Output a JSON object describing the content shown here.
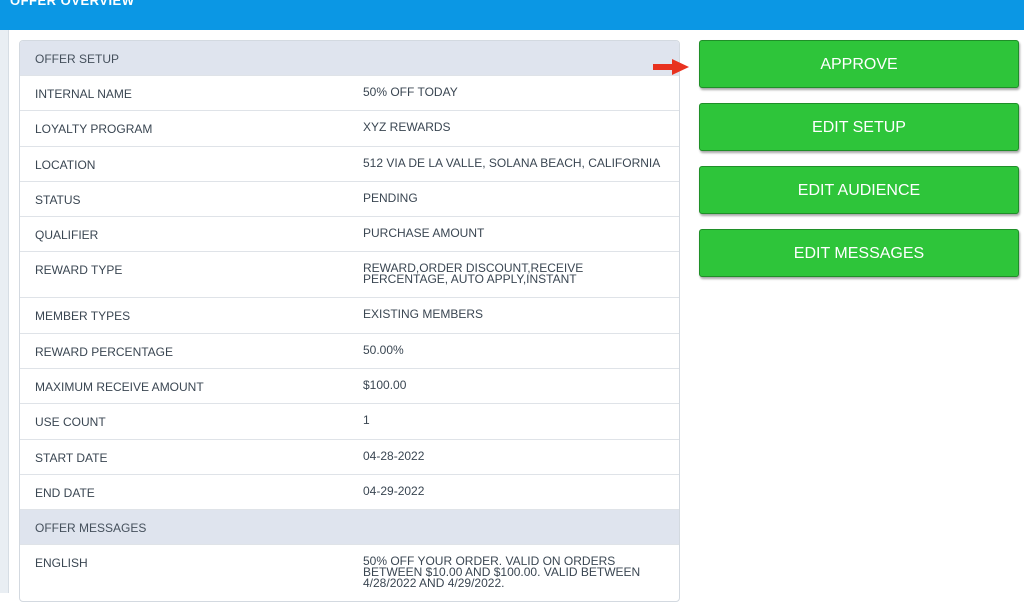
{
  "header": {
    "title": "OFFER OVERVIEW"
  },
  "offer_setup": {
    "section_label": "OFFER SETUP",
    "rows": [
      {
        "label": "INTERNAL NAME",
        "value": "50% OFF TODAY"
      },
      {
        "label": "LOYALTY PROGRAM",
        "value": "XYZ REWARDS"
      },
      {
        "label": "LOCATION",
        "value": "512 VIA DE LA VALLE, SOLANA BEACH, CALIFORNIA"
      },
      {
        "label": "STATUS",
        "value": "PENDING"
      },
      {
        "label": "QUALIFIER",
        "value": "PURCHASE AMOUNT"
      },
      {
        "label": "REWARD TYPE",
        "value": "REWARD,ORDER DISCOUNT,RECEIVE PERCENTAGE, AUTO APPLY,INSTANT"
      },
      {
        "label": "MEMBER TYPES",
        "value": "EXISTING MEMBERS"
      },
      {
        "label": "REWARD PERCENTAGE",
        "value": "50.00%"
      },
      {
        "label": "MAXIMUM RECEIVE AMOUNT",
        "value": "$100.00"
      },
      {
        "label": "USE COUNT",
        "value": "1"
      },
      {
        "label": "START DATE",
        "value": "04-28-2022"
      },
      {
        "label": "END DATE",
        "value": "04-29-2022"
      }
    ]
  },
  "offer_messages": {
    "section_label": "OFFER MESSAGES",
    "rows": [
      {
        "label": "ENGLISH",
        "value": "50% OFF YOUR ORDER. VALID ON ORDERS BETWEEN $10.00 AND $100.00. VALID BETWEEN 4/28/2022 AND 4/29/2022."
      }
    ]
  },
  "actions": {
    "approve": "APPROVE",
    "edit_setup": "EDIT SETUP",
    "edit_audience": "EDIT AUDIENCE",
    "edit_messages": "EDIT MESSAGES"
  },
  "icons": {
    "pointer": "red-arrow-right-icon"
  },
  "colors": {
    "header": "#0b97e4",
    "button": "#2ec53a",
    "section_bg": "#dfe4ee",
    "arrow": "#e8321f"
  }
}
